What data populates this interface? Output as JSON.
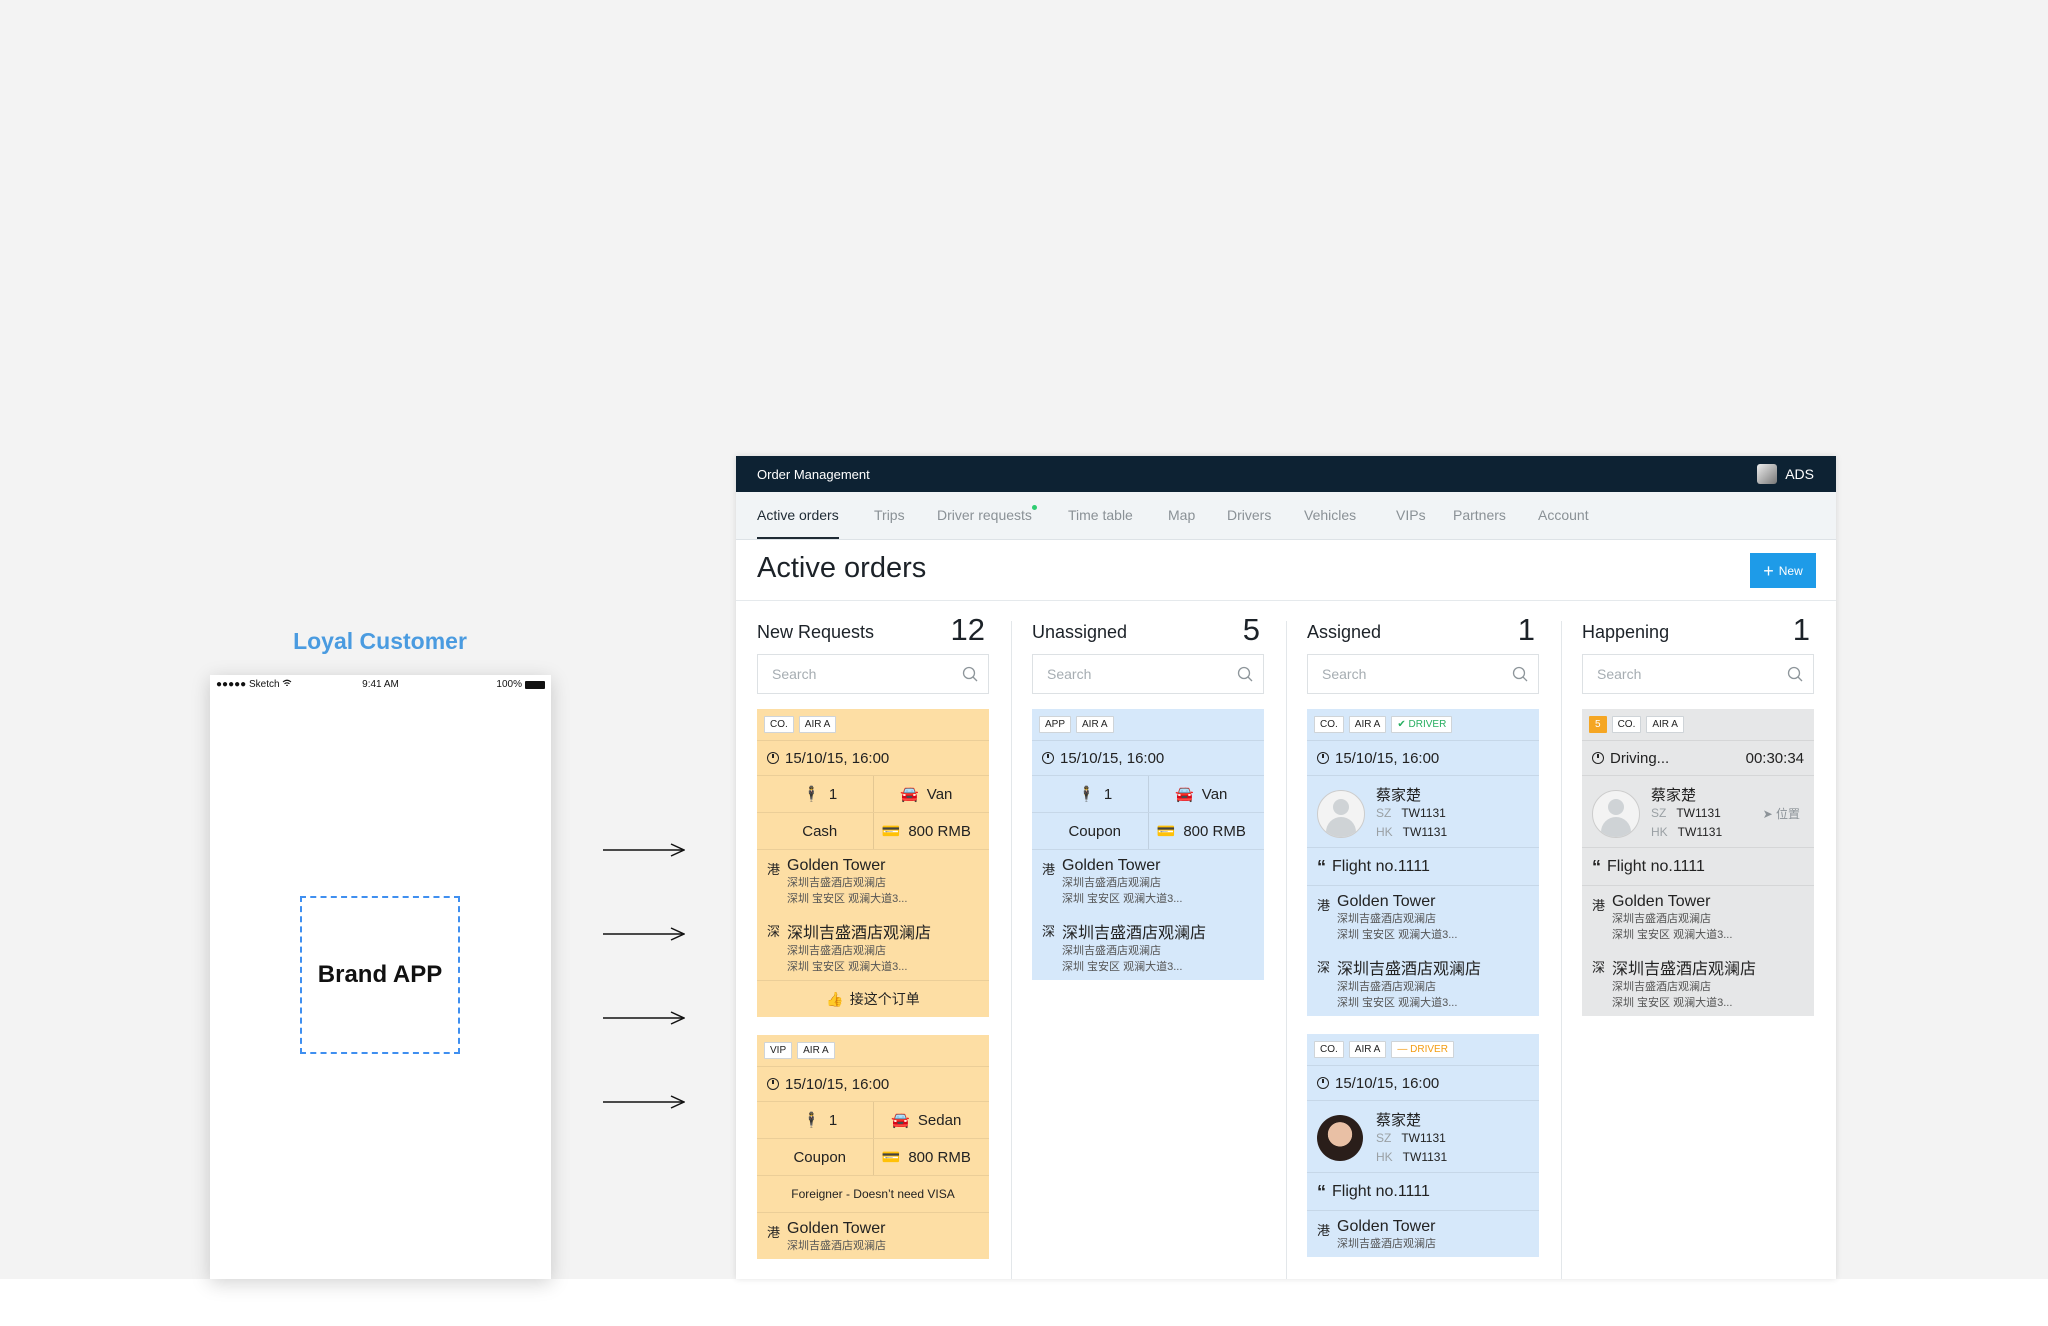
{
  "phone": {
    "caption": "Loyal Customer",
    "status_left": "●●●●● Sketch",
    "status_time": "9:41 AM",
    "status_battery": "100%",
    "brand_label": "Brand APP"
  },
  "app": {
    "window_title": "Order Management",
    "user_name": "ADS",
    "tabs": [
      "Active orders",
      "Trips",
      "Driver requests",
      "Time table",
      "Map",
      "Drivers",
      "Vehicles",
      "VIPs",
      "Partners",
      "Account"
    ],
    "page_title": "Active orders",
    "new_button": "New",
    "search_placeholder": "Search"
  },
  "columns": [
    {
      "name": "New Requests",
      "count": "12"
    },
    {
      "name": "Unassigned",
      "count": "5"
    },
    {
      "name": "Assigned",
      "count": "1"
    },
    {
      "name": "Happening",
      "count": "1"
    }
  ],
  "cards": {
    "c1": {
      "tags": [
        "CO.",
        "AIR A"
      ],
      "datetime": "15/10/15, 16:00",
      "passengers": "1",
      "vehicle": "Van",
      "payment": "Cash",
      "price": "800 RMB",
      "from_char": "港",
      "from": "Golden Tower",
      "from_sub1": "深圳吉盛酒店观澜店",
      "from_sub2": "深圳 宝安区 观澜大道3...",
      "to_char": "深",
      "to": "深圳吉盛酒店观澜店",
      "to_sub1": "深圳吉盛酒店观澜店",
      "to_sub2": "深圳 宝安区 观澜大道3...",
      "accept": "接这个订单"
    },
    "c2": {
      "tags": [
        "VIP",
        "AIR A"
      ],
      "datetime": "15/10/15, 16:00",
      "passengers": "1",
      "vehicle": "Sedan",
      "payment": "Coupon",
      "price": "800 RMB",
      "note": "Foreigner - Doesn’t need VISA",
      "from_char": "港",
      "from": "Golden Tower",
      "from_sub1": "深圳吉盛酒店观澜店"
    },
    "c3": {
      "tags": [
        "APP",
        "AIR A"
      ],
      "datetime": "15/10/15, 16:00",
      "passengers": "1",
      "vehicle": "Van",
      "payment": "Coupon",
      "price": "800 RMB",
      "from_char": "港",
      "from": "Golden Tower",
      "from_sub1": "深圳吉盛酒店观澜店",
      "from_sub2": "深圳 宝安区 观澜大道3...",
      "to_char": "深",
      "to": "深圳吉盛酒店观澜店",
      "to_sub1": "深圳吉盛酒店观澜店",
      "to_sub2": "深圳 宝安区 观澜大道3..."
    },
    "c4": {
      "tags": [
        "CO.",
        "AIR A"
      ],
      "driver_tag": "✔ DRIVER",
      "datetime": "15/10/15, 16:00",
      "driver_name": "蔡家楚",
      "sz": "SZ",
      "hk": "HK",
      "sz_code": "TW1131",
      "hk_code": "TW1131",
      "flight": "Flight no.1111",
      "from_char": "港",
      "from": "Golden Tower",
      "from_sub1": "深圳吉盛酒店观澜店",
      "from_sub2": "深圳 宝安区 观澜大道3...",
      "to_char": "深",
      "to": "深圳吉盛酒店观澜店",
      "to_sub1": "深圳吉盛酒店观澜店",
      "to_sub2": "深圳 宝安区 观澜大道3..."
    },
    "c5": {
      "tags": [
        "CO.",
        "AIR A"
      ],
      "driver_tag": "— DRIVER",
      "datetime": "15/10/15, 16:00",
      "driver_name": "蔡家楚",
      "sz": "SZ",
      "hk": "HK",
      "sz_code": "TW1131",
      "hk_code": "TW1131",
      "flight": "Flight no.1111",
      "from_char": "港",
      "from": "Golden Tower",
      "from_sub1": "深圳吉盛酒店观澜店"
    },
    "c6": {
      "num_tag": "5",
      "tags": [
        "CO.",
        "AIR A"
      ],
      "status": "Driving...",
      "timer": "00:30:34",
      "driver_name": "蔡家楚",
      "sz": "SZ",
      "hk": "HK",
      "sz_code": "TW1131",
      "hk_code": "TW1131",
      "location_label": "位置",
      "flight": "Flight no.1111",
      "from_char": "港",
      "from": "Golden Tower",
      "from_sub1": "深圳吉盛酒店观澜店",
      "from_sub2": "深圳 宝安区 观澜大道3...",
      "to_char": "深",
      "to": "深圳吉盛酒店观澜店",
      "to_sub1": "深圳吉盛酒店观澜店",
      "to_sub2": "深圳 宝安区 观澜大道3..."
    }
  },
  "colors": {
    "accent": "#1e9be8",
    "topbar": "#0d2233",
    "orange_card": "#fddea4",
    "blue_card": "#d6e8fa",
    "gray_card": "#e6e7e8",
    "caption": "#4a9be0"
  },
  "icons": [
    "search-icon",
    "clock-icon",
    "person-icon",
    "car-icon",
    "credit-card-icon",
    "thumbs-up-icon",
    "quote-icon",
    "location-arrow-icon",
    "plus-icon",
    "arrow-right-icon",
    "wifi-icon",
    "battery-icon"
  ]
}
